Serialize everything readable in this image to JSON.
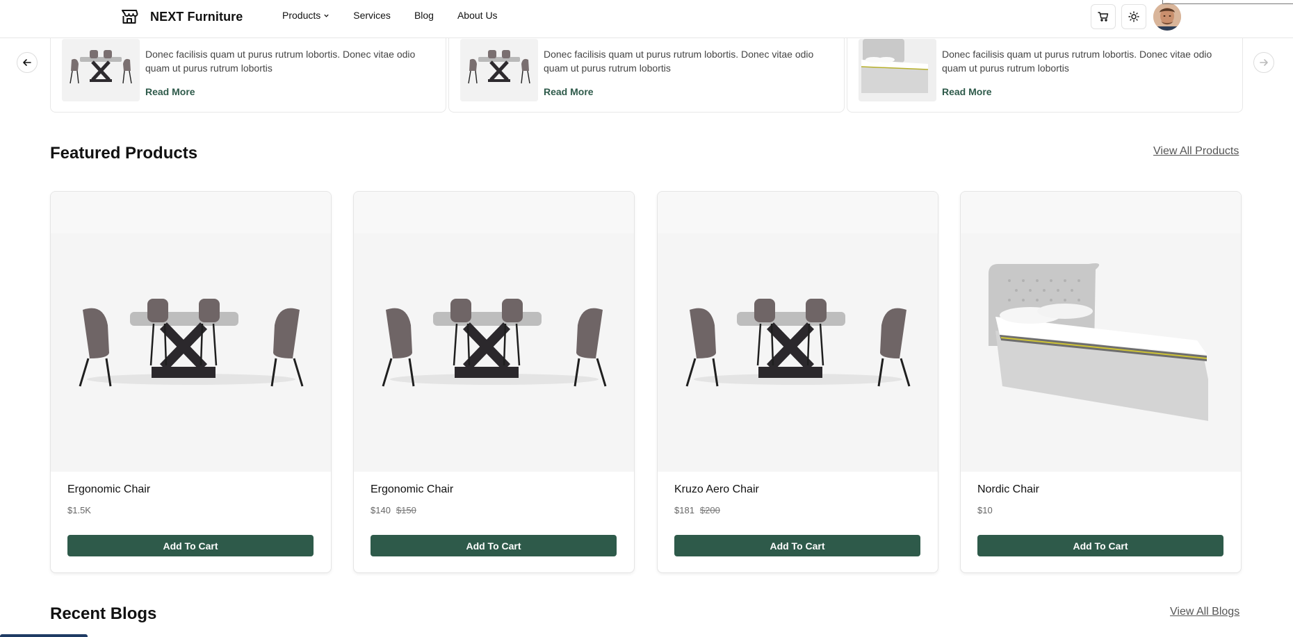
{
  "header": {
    "brand": "NEXT Furniture",
    "nav": [
      "Products",
      "Services",
      "Blog",
      "About Us"
    ],
    "icons": [
      "cart-icon",
      "sun-icon"
    ]
  },
  "blog_slider": {
    "cards": [
      {
        "excerpt": "Donec facilisis quam ut purus rutrum lobortis. Donec vitae odio quam ut purus rutrum lobortis",
        "read_more": "Read More",
        "image": "dining-set"
      },
      {
        "excerpt": "Donec facilisis quam ut purus rutrum lobortis. Donec vitae odio quam ut purus rutrum lobortis",
        "read_more": "Read More",
        "image": "dining-set"
      },
      {
        "excerpt": "Donec facilisis quam ut purus rutrum lobortis. Donec vitae odio quam ut purus rutrum lobortis",
        "read_more": "Read More",
        "image": "bed"
      }
    ]
  },
  "featured": {
    "title": "Featured Products",
    "view_all": "View All Products",
    "products": [
      {
        "name": "Ergonomic Chair",
        "price": "$1.5K",
        "old_price": "",
        "image": "dining-set",
        "button": "Add To Cart"
      },
      {
        "name": "Ergonomic Chair",
        "price": "$140",
        "old_price": "$150",
        "image": "dining-set",
        "button": "Add To Cart"
      },
      {
        "name": "Kruzo Aero Chair",
        "price": "$181",
        "old_price": "$200",
        "image": "dining-set",
        "button": "Add To Cart"
      },
      {
        "name": "Nordic Chair",
        "price": "$10",
        "old_price": "",
        "image": "bed",
        "button": "Add To Cart"
      }
    ]
  },
  "recent_blogs": {
    "title": "Recent Blogs",
    "view_all": "View All Blogs"
  },
  "colors": {
    "accent": "#2e5a4a",
    "card_bg": "#f5f5f5",
    "border": "#e5e5e5"
  }
}
